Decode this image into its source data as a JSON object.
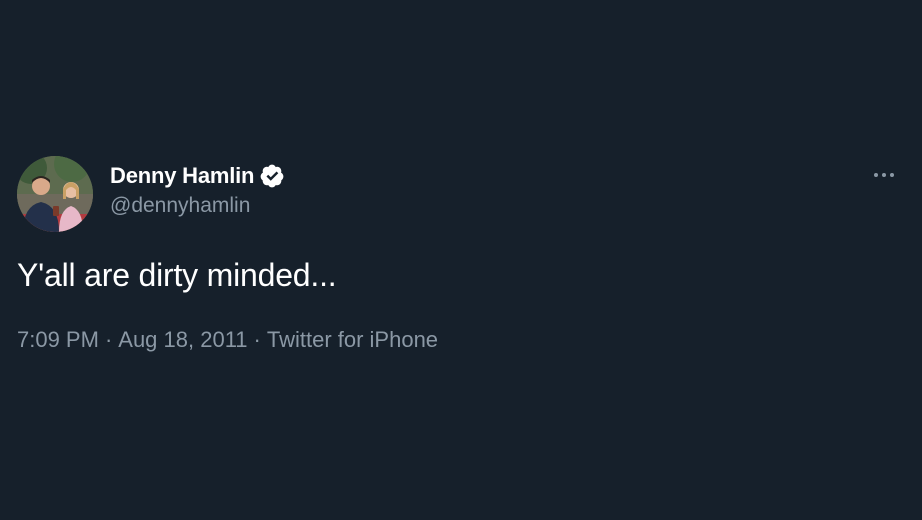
{
  "tweet": {
    "author": {
      "display_name": "Denny Hamlin",
      "handle": "@dennyhamlin",
      "verified": true,
      "avatar_icon": "profile-photo"
    },
    "more_icon": "more-horizontal-icon",
    "text": "Y'all are dirty minded...",
    "time": "7:09 PM",
    "date": "Aug 18, 2011",
    "source": "Twitter for iPhone",
    "separator": "·"
  },
  "colors": {
    "background": "#16202b",
    "primary_text": "#ffffff",
    "secondary_text": "#8b98a5"
  }
}
